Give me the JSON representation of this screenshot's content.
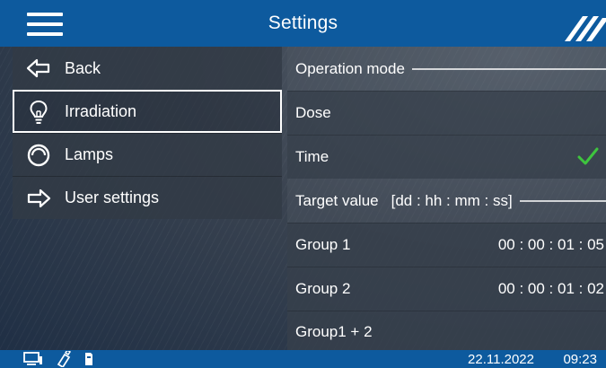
{
  "header": {
    "title": "Settings",
    "menu_icon": "hamburger-menu-icon",
    "logo_icon": "brand-stripes-logo"
  },
  "sidebar": {
    "items": [
      {
        "label": "Back",
        "icon": "arrow-left-icon",
        "selected": false
      },
      {
        "label": "Irradiation",
        "icon": "light-bulb-icon",
        "selected": true
      },
      {
        "label": "Lamps",
        "icon": "lamp-ring-icon",
        "selected": false
      },
      {
        "label": "User settings",
        "icon": "arrow-right-icon",
        "selected": false
      }
    ]
  },
  "main": {
    "operation_mode": {
      "label": "Operation mode"
    },
    "modes": [
      {
        "label": "Dose",
        "checked": false
      },
      {
        "label": "Time",
        "checked": true
      }
    ],
    "target_value": {
      "label": "Target value",
      "unit": "[dd : hh : mm : ss]"
    },
    "groups": [
      {
        "label": "Group 1",
        "value": "00 : 00 : 01 : 05"
      },
      {
        "label": "Group 2",
        "value": "00 : 00 : 01 : 02"
      },
      {
        "label": "Group1 + 2",
        "value": ""
      }
    ]
  },
  "footer": {
    "icons": [
      "monitor-icon",
      "usb-stick-icon",
      "sd-card-icon"
    ],
    "date": "22.11.2022",
    "time": "09:23"
  },
  "colors": {
    "header_bar": "#0d5a9e",
    "check": "#3ec43e",
    "text": "#ffffff"
  }
}
